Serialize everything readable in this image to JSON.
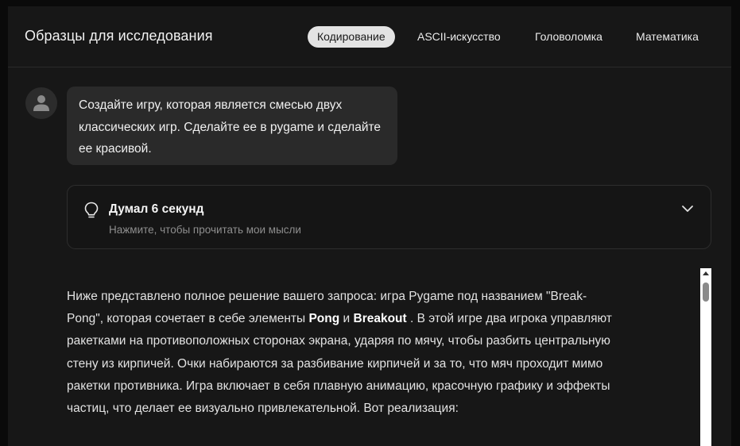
{
  "header": {
    "title": "Образцы для исследования",
    "tabs": [
      {
        "label": "Кодирование",
        "active": true
      },
      {
        "label": "ASCII-искусство",
        "active": false
      },
      {
        "label": "Головоломка",
        "active": false
      },
      {
        "label": "Математика",
        "active": false
      }
    ]
  },
  "user_message": {
    "avatar_icon": "user-icon",
    "text": "Создайте игру, которая является смесью двух классических игр. Сделайте ее в pygame и сделайте ее красивой."
  },
  "thought": {
    "icon": "lightbulb-icon",
    "title": "Думал 6 секунд",
    "subtitle": "Нажмите, чтобы прочитать мои мысли",
    "expand_icon": "chevron-down-icon"
  },
  "answer": {
    "part1": "Ниже представлено полное решение вашего запроса: игра Pygame под названием \"Break-Pong\", которая сочетает в себе элементы ",
    "bold1": "Pong",
    "part2": " и ",
    "bold2": "Breakout",
    "part3": " . В этой игре два игрока управляют ракетками на противоположных сторонах экрана, ударяя по мячу, чтобы разбить центральную стену из кирпичей. Очки набираются за разбивание кирпичей и за то, что мяч проходит мимо ракетки противника. Игра включает в себя плавную анимацию, красочную графику и эффекты частиц, что делает ее визуально привлекательной. Вот реализация:"
  },
  "colors": {
    "background": "#0a0a0a",
    "panel": "#171717",
    "active_tab": "#e3e3e3",
    "bubble": "#2a2a2a"
  }
}
